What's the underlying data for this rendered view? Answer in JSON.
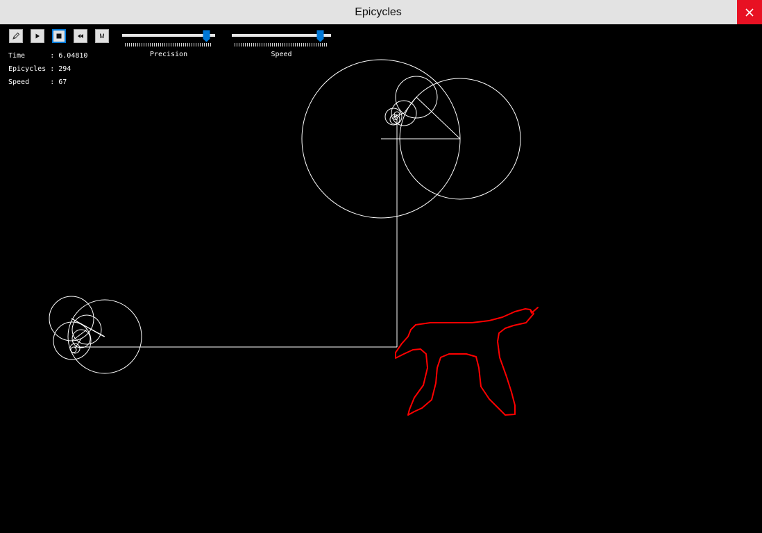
{
  "window": {
    "title": "Epicycles"
  },
  "toolbar": {
    "buttons": [
      {
        "name": "draw-button",
        "icon": "pencil-icon",
        "label": ""
      },
      {
        "name": "play-button",
        "icon": "play-icon",
        "label": ""
      },
      {
        "name": "stop-button",
        "icon": "stop-icon",
        "label": ""
      },
      {
        "name": "rewind-button",
        "icon": "rewind-icon",
        "label": ""
      },
      {
        "name": "mode-button",
        "icon": "",
        "label": "M"
      }
    ],
    "active_button": "stop-button",
    "precision_slider": {
      "label": "Precision",
      "level_fraction": 0.88
    },
    "speed_slider": {
      "label": "Speed",
      "level_fraction": 0.88
    }
  },
  "info": {
    "time_label": "Time",
    "time_value": "6.04810",
    "epicycles_label": "Epicycles",
    "epicycles_value": "294",
    "speed_label": "Speed",
    "speed_value": "67"
  },
  "colors": {
    "background": "#000000",
    "epicycle_lines": "#ffffff",
    "drawn_path": "#ff0000",
    "slider_thumb": "#0078d7",
    "close_button": "#e81123",
    "titlebar": "#e3e3e3"
  }
}
